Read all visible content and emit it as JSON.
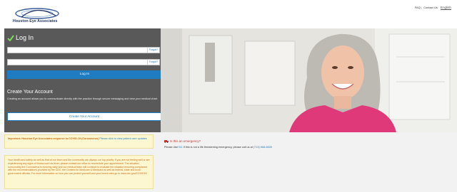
{
  "header": {
    "logo_text": "Houston Eye Associates",
    "links": {
      "faq": "FAQ",
      "contact": "Contact Us",
      "language": "English"
    }
  },
  "login": {
    "title": "Log In",
    "username_placeholder": "",
    "password_placeholder": "",
    "forgot_username": "Forgot?",
    "forgot_password": "Forgot?",
    "button": "Log In"
  },
  "create_account": {
    "title": "Create Your Account",
    "description": "Creating an account allows you to communicate directly with the practice through secure messaging and view your medical chart.",
    "button": "Create Your Account"
  },
  "notices": {
    "covid_title": "Important: Houston Eye Associates response to COVID-19 (Coronavirus)",
    "covid_link": "Please click to view patient care updates",
    "covid_body": "Your health and safety as well as that of our team and the community are always our top priority. If you are not feeling well or are experiencing any signs of illness such as fever, please contact our office to reschedule your appointment. The situation surrounding the Coronavirus is evolving daily and our medical team will continue to evaluate the situation ensuring compliance with the recommendations provided by the CDC, the Centers for Medicare & Medicaid as well as federal, state and local government officials. For more information on how you can protect yourself and your loved ones go to www.cdc.gov/COVID19."
  },
  "emergency": {
    "title": "Is this an emergency?",
    "text_before": "Please dial ",
    "number_911": "911",
    "text_middle": " if this is not a life threatening emergency, please call us at ",
    "phone": "(713) 668-6828"
  },
  "colors": {
    "primary": "#1f7cc1",
    "panel": "#595959",
    "notice_bg": "#fdf7d1",
    "notice_text": "#c96a12",
    "emergency": "#c0392b"
  }
}
